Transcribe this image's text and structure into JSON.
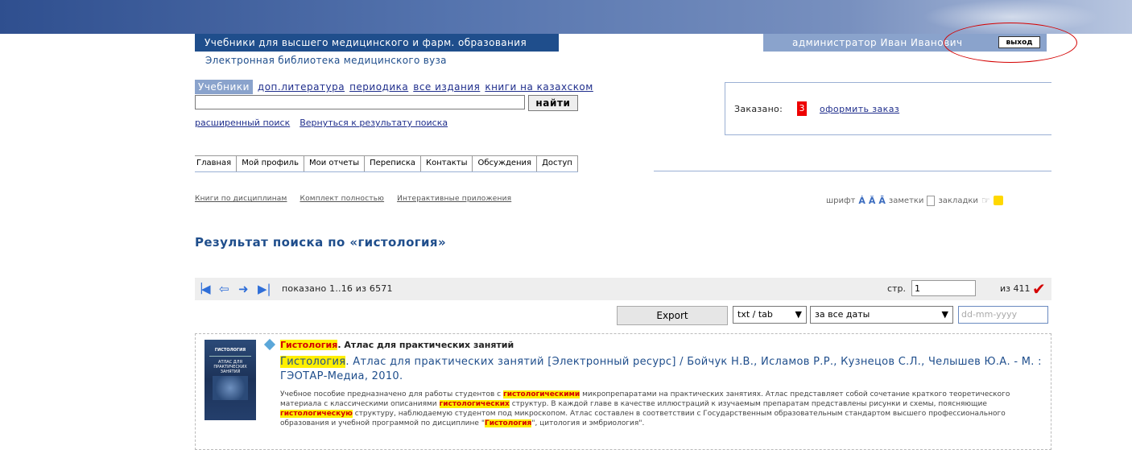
{
  "header": {
    "brand_title": "Учебники для высшего медицинского и фарм. образования",
    "brand_subtitle": "Электронная библиотека медицинского вуза",
    "user_label": "администратор Иван Иванович",
    "logout_label": "выход"
  },
  "tabs": {
    "active": "Учебники",
    "items": [
      "доп.литература",
      "периодика",
      "все издания",
      "книги на казахском"
    ]
  },
  "search": {
    "value": "",
    "button_label": "найти",
    "advanced_link": "расширенный поиск",
    "back_link": "Вернуться к результату поиска"
  },
  "order": {
    "label": "Заказано:",
    "count": "3",
    "link": "оформить заказ"
  },
  "nav": [
    "Главная",
    "Мой профиль",
    "Мои отчеты",
    "Переписка",
    "Контакты",
    "Обсуждения",
    "Доступ"
  ],
  "category_links": [
    "Книги по дисциплинам",
    "Комплект полностью",
    "Интерактивные приложения"
  ],
  "tools": {
    "font_label": "шрифт",
    "notes_label": "заметки",
    "bookmarks_label": "закладки"
  },
  "results": {
    "title": "Результат поиска по «гистология»",
    "shown": "показано 1..16 из 6571",
    "page_label": "стр.",
    "page_value": "1",
    "page_total": "из 411",
    "export_label": "Export",
    "format_value": "txt / tab",
    "dates_value": "за все даты",
    "date_placeholder": "dd-mm-yyyy"
  },
  "record": {
    "cover_title": "ГИСТОЛОГИЯ",
    "cover_subtitle": "АТЛАС ДЛЯ ПРАКТИЧЕСКИХ ЗАНЯТИЙ",
    "head_hl": "Гистология",
    "head_rest": ". Атлас для практических занятий",
    "cite_hl": "Гистология",
    "cite_rest": ". Атлас для практических занятий [Электронный ресурс] / Бойчук Н.В., Исламов Р.Р., Кузнецов С.Л., Челышев Ю.А. - М. : ГЭОТАР-Медиа, 2010.",
    "abs_1": "Учебное пособие предназначено для работы студентов с ",
    "abs_hl1": "гистологическими",
    "abs_2": " микропрепаратами на практических занятиях. Атлас представляет собой сочетание краткого теоретического материала с классическими описаниями ",
    "abs_hl2": "гистологических",
    "abs_3": " структур. В каждой главе в качестве иллюстраций к изучаемым препаратам представлены рисунки и схемы, поясняющие ",
    "abs_hl3": "гистологическую",
    "abs_4": " структуру, наблюдаемую студентом под микроскопом. Атлас составлен в соответствии с Государственным образовательным стандартом высшего профессионального образования и учебной программой по дисциплине \"",
    "abs_hl4": "Гистология",
    "abs_5": "\", цитология и эмбриология\"."
  }
}
